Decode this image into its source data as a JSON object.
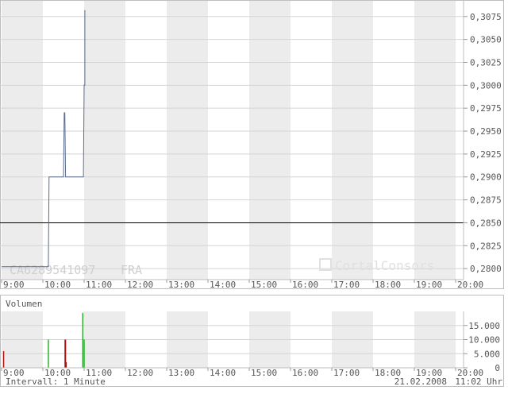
{
  "price_panel": {
    "isin": "CA6289541097",
    "exchange": "FRA",
    "watermark": "CortalConsors",
    "ylabels": [
      "0,3075",
      "0,3050",
      "0,3025",
      "0,3000",
      "0,2975",
      "0,2950",
      "0,2925",
      "0,2900",
      "0,2875",
      "0,2850",
      "0,2825",
      "0,2800"
    ],
    "xlabels": [
      "9:00",
      "10:00",
      "11:00",
      "12:00",
      "13:00",
      "14:00",
      "15:00",
      "16:00",
      "17:00",
      "18:00",
      "19:00",
      "20:00"
    ]
  },
  "volume_panel": {
    "title": "Volumen",
    "ylabels": [
      "15.000",
      "10.000",
      "5.000",
      "0"
    ],
    "xlabels": [
      "9:00",
      "10:00",
      "11:00",
      "12:00",
      "13:00",
      "14:00",
      "15:00",
      "16:00",
      "17:00",
      "18:00",
      "19:00",
      "20:00"
    ]
  },
  "footer": {
    "interval": "Intervall: 1 Minute",
    "date": "21.02.2008",
    "time": "11:02 Uhr"
  },
  "colors": {
    "price_line": "#5a6b8c",
    "reference_line": "#000000",
    "volume_up": "#22aa22",
    "volume_down": "#aa1111",
    "band_shade": "#ececec",
    "grid": "#d4d4d4"
  },
  "chart_data": [
    {
      "type": "line",
      "x_range": [
        "9:00",
        "20:00"
      ],
      "ylim": [
        0.2788,
        0.3093
      ],
      "reference_line": 0.285,
      "series": [
        {
          "x": [
            "9:00",
            "10:08",
            "10:09",
            "10:30",
            "10:31",
            "10:32",
            "10:33",
            "10:34",
            "10:59",
            "11:00",
            "11:01",
            "11:01"
          ],
          "y": [
            0.2802,
            0.2802,
            0.29,
            0.29,
            0.297,
            0.297,
            0.29,
            0.29,
            0.29,
            0.3,
            0.3,
            0.3082
          ]
        }
      ],
      "grid": true
    },
    {
      "type": "bar",
      "title": "Volumen",
      "ylim": [
        0,
        20000
      ],
      "bars": [
        {
          "x": "9:03",
          "value": 5900,
          "direction": "down"
        },
        {
          "x": "10:08",
          "value": 10000,
          "direction": "up"
        },
        {
          "x": "10:32",
          "value": 10000,
          "direction": "up"
        },
        {
          "x": "10:33",
          "value": 10000,
          "direction": "down"
        },
        {
          "x": "10:34",
          "value": 2000,
          "direction": "down"
        },
        {
          "x": "10:58",
          "value": 19500,
          "direction": "up"
        },
        {
          "x": "11:00",
          "value": 10000,
          "direction": "up"
        }
      ]
    }
  ]
}
